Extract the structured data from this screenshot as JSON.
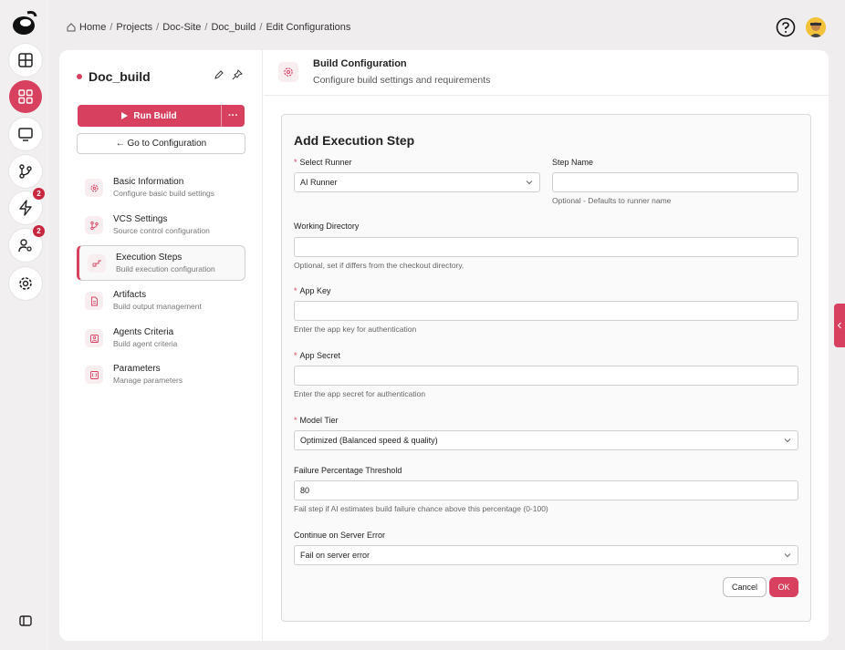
{
  "breadcrumb": [
    "Home",
    "Projects",
    "Doc-Site",
    "Doc_build",
    "Edit Configurations"
  ],
  "rail": {
    "badge_builds": "2",
    "badge_users": "2"
  },
  "project": {
    "name": "Doc_build",
    "run_label": "Run Build",
    "more_label": "···",
    "goto_label": "← Go to Configuration"
  },
  "nav": [
    {
      "title": "Basic Information",
      "subtitle": "Configure basic build settings",
      "icon": "gear-icon"
    },
    {
      "title": "VCS Settings",
      "subtitle": "Source control configuration",
      "icon": "branch-icon"
    },
    {
      "title": "Execution Steps",
      "subtitle": "Build execution configuration",
      "icon": "steps-icon"
    },
    {
      "title": "Artifacts",
      "subtitle": "Build output management",
      "icon": "file-icon"
    },
    {
      "title": "Agents Criteria",
      "subtitle": "Build agent criteria",
      "icon": "agent-icon"
    },
    {
      "title": "Parameters",
      "subtitle": "Manage parameters",
      "icon": "params-icon"
    }
  ],
  "header": {
    "title": "Build Configuration",
    "subtitle": "Configure build settings and requirements"
  },
  "form": {
    "title": "Add Execution Step",
    "runner_label": "Select Runner",
    "runner_value": "AI Runner",
    "step_name_label": "Step Name",
    "step_name_value": "",
    "step_name_hint": "Optional - Defaults to runner name",
    "workdir_label": "Working Directory",
    "workdir_value": "",
    "workdir_hint": "Optional, set if differs from the checkout directory.",
    "appkey_label": "App Key",
    "appkey_value": "",
    "appkey_hint": "Enter the app key for authentication",
    "appsecret_label": "App Secret",
    "appsecret_value": "",
    "appsecret_hint": "Enter the app secret for authentication",
    "tier_label": "Model Tier",
    "tier_value": "Optimized (Balanced speed & quality)",
    "threshold_label": "Failure Percentage Threshold",
    "threshold_value": "80",
    "threshold_hint": "Fail step if AI estimates build failure chance above this percentage (0-100)",
    "server_error_label": "Continue on Server Error",
    "server_error_value": "Fail on server error",
    "cancel_label": "Cancel",
    "ok_label": "OK"
  },
  "colors": {
    "accent": "#d7405f",
    "background": "#efedee"
  }
}
